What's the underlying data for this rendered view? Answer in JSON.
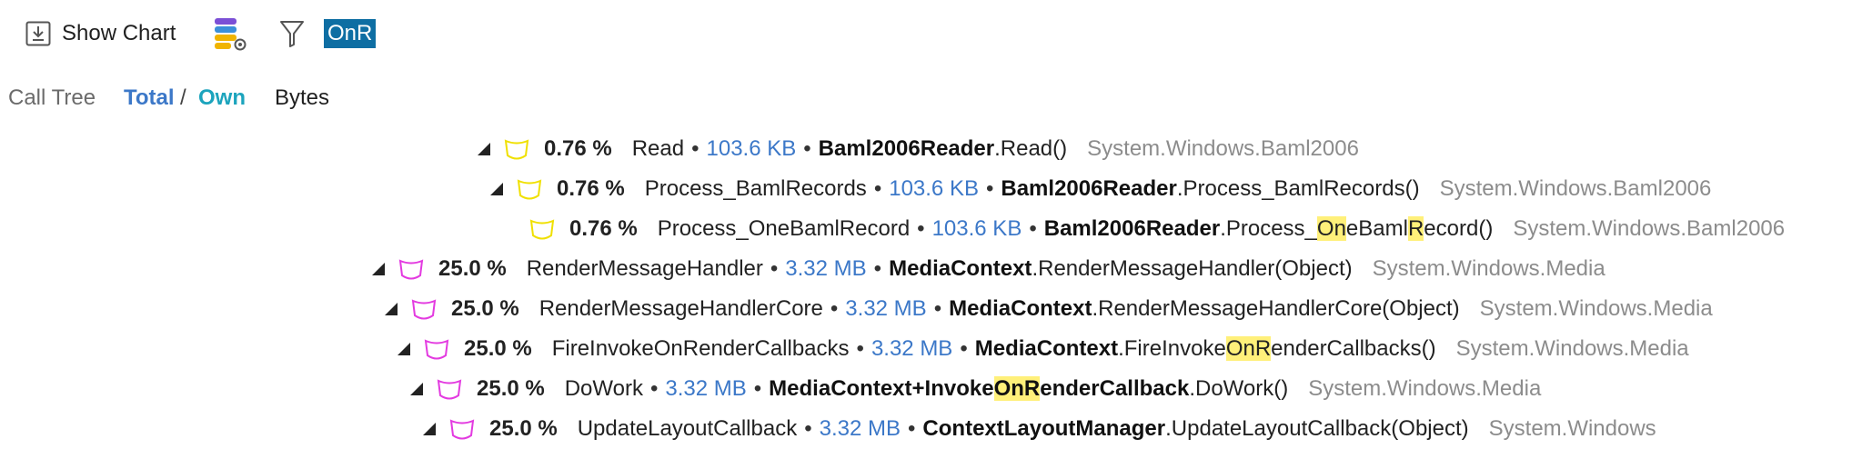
{
  "toolbar": {
    "show_chart_label": "Show Chart",
    "show_chart_icon": "chart-download-icon",
    "stack_icon": "stack-view-icon",
    "filter_icon": "filter-icon",
    "search_value": "OnR",
    "search_bg": "#0e6ea3"
  },
  "view": {
    "call_tree": "Call Tree",
    "total": "Total",
    "slash": "/",
    "own": "Own",
    "bytes": "Bytes"
  },
  "colors": {
    "size_blue": "#3c78c8",
    "highlight": "#fff07a",
    "cyl_yellow": "#f0e000",
    "cyl_magenta": "#e33ae0"
  },
  "tree": [
    {
      "expanded": true,
      "color": "yellow",
      "percent": "0.76 %",
      "func": "Read",
      "size": "103.6 KB",
      "method_parts": [
        {
          "t": "Baml2006Reader",
          "b": true
        },
        {
          "t": ".Read()"
        }
      ],
      "namespace": "System.Windows.Baml2006"
    },
    {
      "expanded": true,
      "color": "yellow",
      "percent": "0.76 %",
      "func": "Process_BamlRecords",
      "size": "103.6 KB",
      "method_parts": [
        {
          "t": "Baml2006Reader",
          "b": true
        },
        {
          "t": ".Process_BamlRecords()"
        }
      ],
      "namespace": "System.Windows.Baml2006"
    },
    {
      "expanded": false,
      "color": "yellow",
      "percent": "0.76 %",
      "func": "Process_OneBamlRecord",
      "size": "103.6 KB",
      "method_parts": [
        {
          "t": "Baml2006Reader",
          "b": true
        },
        {
          "t": ".Process_"
        },
        {
          "t": "On",
          "h": true
        },
        {
          "t": "eBaml"
        },
        {
          "t": "R",
          "h": true
        },
        {
          "t": "ecord()"
        }
      ],
      "namespace": "System.Windows.Baml2006"
    },
    {
      "expanded": true,
      "color": "magenta",
      "percent": "25.0 %",
      "func": "RenderMessageHandler",
      "size": "3.32 MB",
      "method_parts": [
        {
          "t": "MediaContext",
          "b": true
        },
        {
          "t": ".RenderMessageHandler(Object)"
        }
      ],
      "namespace": "System.Windows.Media"
    },
    {
      "expanded": true,
      "color": "magenta",
      "percent": "25.0 %",
      "func": "RenderMessageHandlerCore",
      "size": "3.32 MB",
      "method_parts": [
        {
          "t": "MediaContext",
          "b": true
        },
        {
          "t": ".RenderMessageHandlerCore(Object)"
        }
      ],
      "namespace": "System.Windows.Media"
    },
    {
      "expanded": true,
      "color": "magenta",
      "percent": "25.0 %",
      "func": "FireInvokeOnRenderCallbacks",
      "size": "3.32 MB",
      "method_parts": [
        {
          "t": "MediaContext",
          "b": true
        },
        {
          "t": ".FireInvoke"
        },
        {
          "t": "OnR",
          "h": true
        },
        {
          "t": "enderCallbacks()"
        }
      ],
      "namespace": "System.Windows.Media"
    },
    {
      "expanded": true,
      "color": "magenta",
      "percent": "25.0 %",
      "func": "DoWork",
      "size": "3.32 MB",
      "method_parts": [
        {
          "t": "MediaContext+Invoke",
          "b": true
        },
        {
          "t": "OnR",
          "b": true,
          "h": true
        },
        {
          "t": "enderCallback",
          "b": true
        },
        {
          "t": ".DoWork()"
        }
      ],
      "namespace": "System.Windows.Media"
    },
    {
      "expanded": true,
      "color": "magenta",
      "percent": "25.0 %",
      "func": "UpdateLayoutCallback",
      "size": "3.32 MB",
      "method_parts": [
        {
          "t": "ContextLayoutManager",
          "b": true
        },
        {
          "t": ".UpdateLayoutCallback(Object)"
        }
      ],
      "namespace": "System.Windows"
    }
  ]
}
